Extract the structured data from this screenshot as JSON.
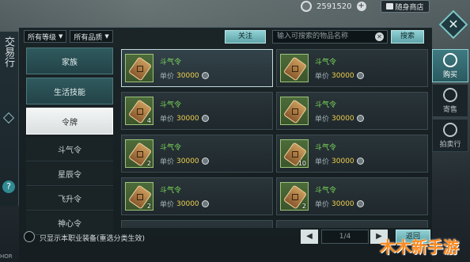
{
  "topbar": {
    "currency_value": "2591520",
    "shop_label": "随身商店"
  },
  "side": {
    "title": "交易行"
  },
  "filters": {
    "level": "所有等级",
    "quality": "所有品质",
    "follow_label": "关注",
    "search_placeholder": "输入可搜索的物品名称",
    "search_label": "搜索"
  },
  "categories": {
    "items": [
      {
        "label": "家族"
      },
      {
        "label": "生活技能"
      },
      {
        "label": "令牌"
      }
    ],
    "subitems": [
      {
        "label": "斗气令"
      },
      {
        "label": "星辰令"
      },
      {
        "label": "飞升令"
      },
      {
        "label": "神心令"
      }
    ]
  },
  "items": [
    {
      "name": "斗气令",
      "price_label": "单价",
      "price": "30000",
      "qty": ""
    },
    {
      "name": "斗气令",
      "price_label": "单价",
      "price": "30000",
      "qty": ""
    },
    {
      "name": "斗气令",
      "price_label": "单价",
      "price": "30000",
      "qty": "4"
    },
    {
      "name": "斗气令",
      "price_label": "单价",
      "price": "30000",
      "qty": ""
    },
    {
      "name": "斗气令",
      "price_label": "单价",
      "price": "30000",
      "qty": "2"
    },
    {
      "name": "斗气令",
      "price_label": "单价",
      "price": "30000",
      "qty": "10"
    },
    {
      "name": "斗气令",
      "price_label": "单价",
      "price": "30000",
      "qty": "2"
    },
    {
      "name": "斗气令",
      "price_label": "单价",
      "price": "30000",
      "qty": "2"
    }
  ],
  "right_tabs": [
    {
      "label": "购买"
    },
    {
      "label": "寄售"
    },
    {
      "label": "拍卖行"
    }
  ],
  "bottom": {
    "checkbox_label": "只显示本职业装备(重选分类生效)",
    "page_indicator": "1/4",
    "back_label": "返回"
  },
  "watermark": "木木新手游",
  "corner": "HOR"
}
